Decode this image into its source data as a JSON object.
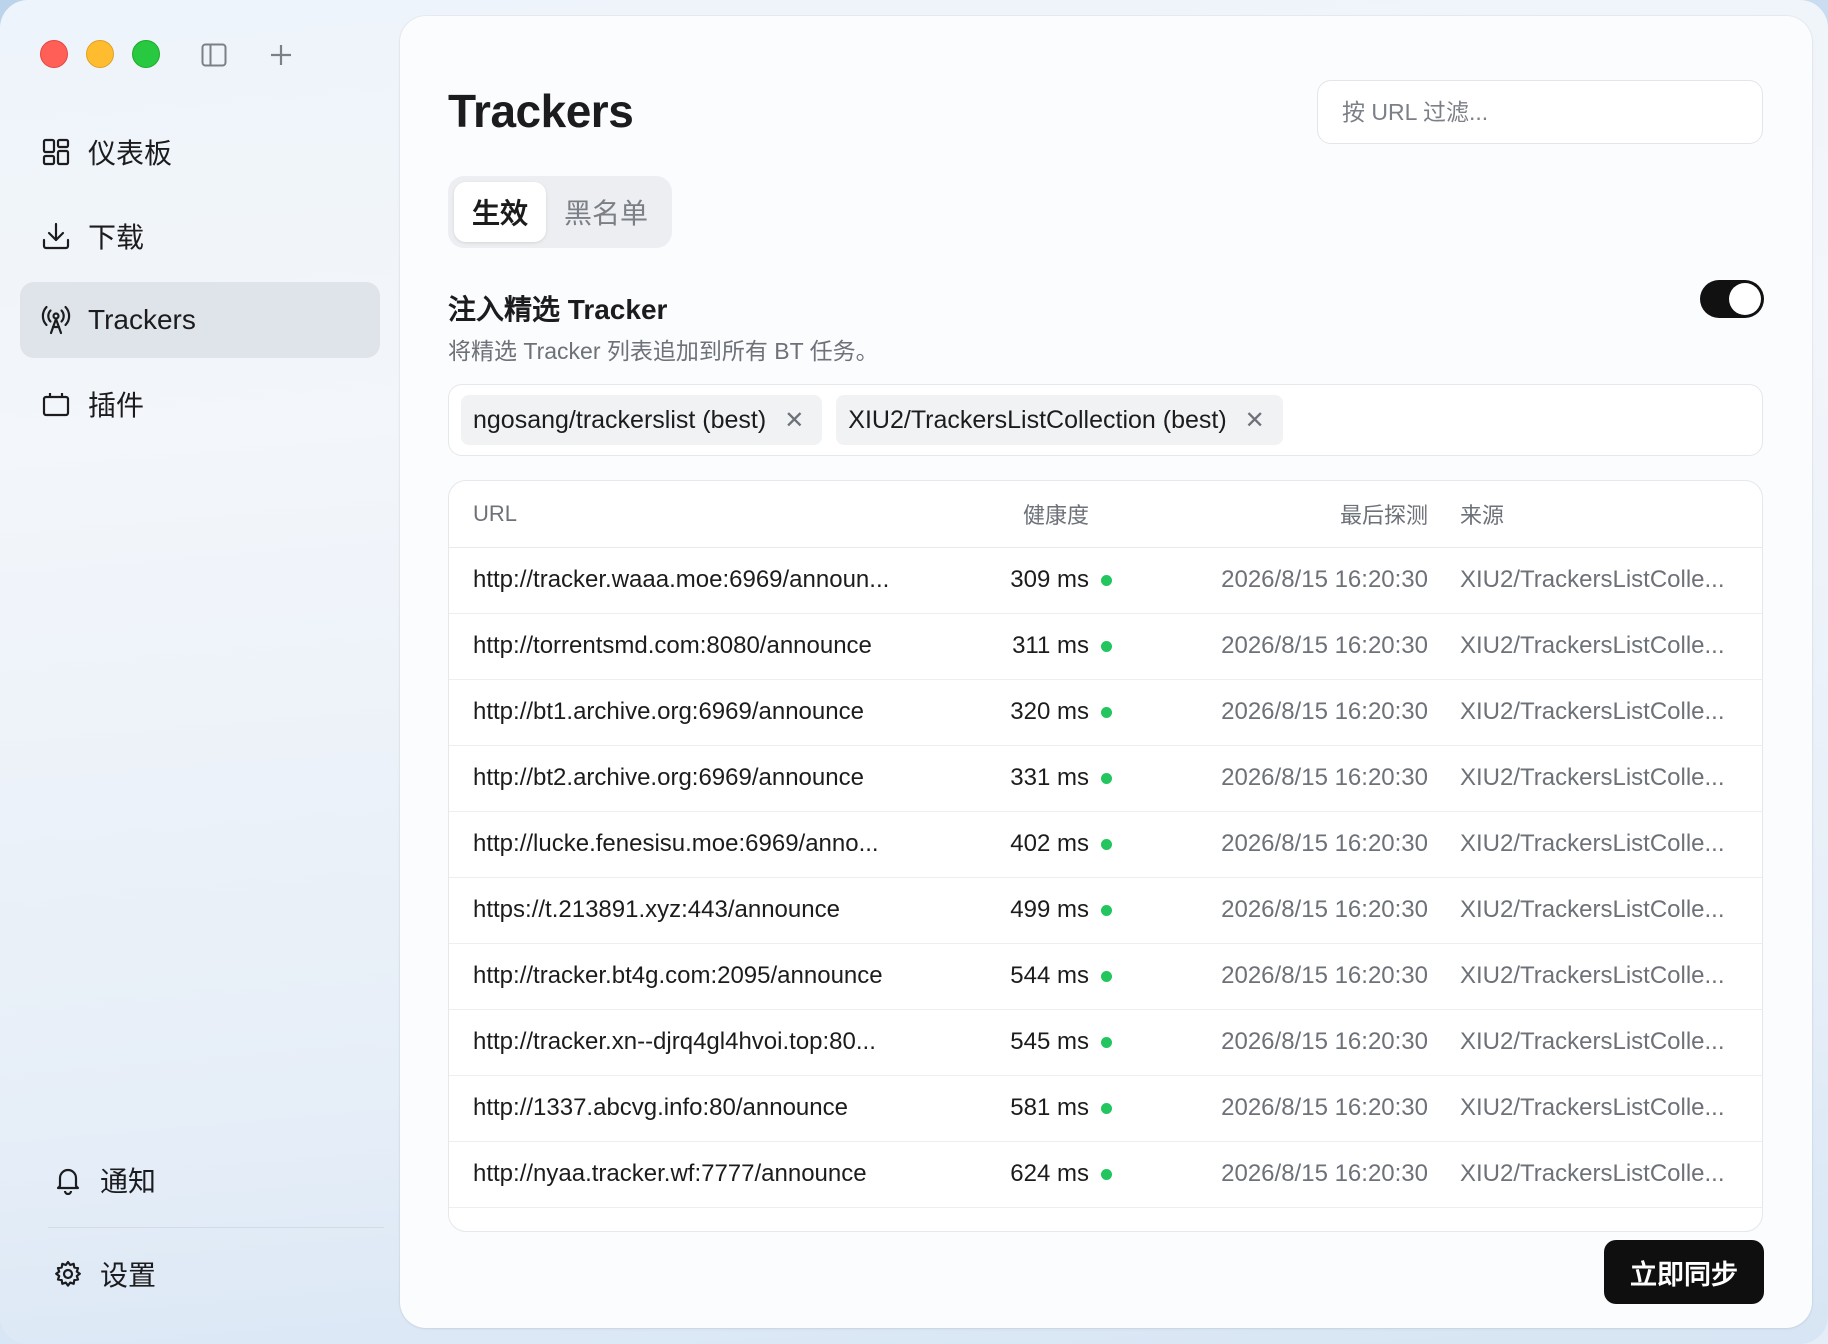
{
  "window": {
    "sidebar": {
      "nav": [
        {
          "id": "dashboard",
          "label": "仪表板",
          "icon": "dashboard-icon",
          "active": false
        },
        {
          "id": "downloads",
          "label": "下载",
          "icon": "download-icon",
          "active": false
        },
        {
          "id": "trackers",
          "label": "Trackers",
          "icon": "antenna-icon",
          "active": true
        },
        {
          "id": "plugins",
          "label": "插件",
          "icon": "plugin-icon",
          "active": false
        }
      ],
      "notifications_label": "通知",
      "settings_label": "设置"
    }
  },
  "main": {
    "title": "Trackers",
    "search_placeholder": "按 URL 过滤...",
    "tabs": [
      {
        "label": "生效",
        "active": true
      },
      {
        "label": "黑名单",
        "active": false
      }
    ],
    "inject": {
      "title": "注入精选 Tracker",
      "description": "将精选 Tracker 列表追加到所有 BT 任务。",
      "enabled": true
    },
    "sources": [
      "ngosang/trackerslist (best)",
      "XIU2/TrackersListCollection (best)"
    ],
    "table": {
      "headers": {
        "url": "URL",
        "health": "健康度",
        "last_probe": "最后探测",
        "source": "来源"
      },
      "rows": [
        {
          "url": "http://tracker.waaa.moe:6969/announ...",
          "health": "309 ms",
          "time": "2026/8/15 16:20:30",
          "source": "XIU2/TrackersListColle..."
        },
        {
          "url": "http://torrentsmd.com:8080/announce",
          "health": "311 ms",
          "time": "2026/8/15 16:20:30",
          "source": "XIU2/TrackersListColle..."
        },
        {
          "url": "http://bt1.archive.org:6969/announce",
          "health": "320 ms",
          "time": "2026/8/15 16:20:30",
          "source": "XIU2/TrackersListColle..."
        },
        {
          "url": "http://bt2.archive.org:6969/announce",
          "health": "331 ms",
          "time": "2026/8/15 16:20:30",
          "source": "XIU2/TrackersListColle..."
        },
        {
          "url": "http://lucke.fenesisu.moe:6969/anno...",
          "health": "402 ms",
          "time": "2026/8/15 16:20:30",
          "source": "XIU2/TrackersListColle..."
        },
        {
          "url": "https://t.213891.xyz:443/announce",
          "health": "499 ms",
          "time": "2026/8/15 16:20:30",
          "source": "XIU2/TrackersListColle..."
        },
        {
          "url": "http://tracker.bt4g.com:2095/announce",
          "health": "544 ms",
          "time": "2026/8/15 16:20:30",
          "source": "XIU2/TrackersListColle..."
        },
        {
          "url": "http://tracker.xn--djrq4gl4hvoi.top:80...",
          "health": "545 ms",
          "time": "2026/8/15 16:20:30",
          "source": "XIU2/TrackersListColle..."
        },
        {
          "url": "http://1337.abcvg.info:80/announce",
          "health": "581 ms",
          "time": "2026/8/15 16:20:30",
          "source": "XIU2/TrackersListColle..."
        },
        {
          "url": "http://nyaa.tracker.wf:7777/announce",
          "health": "624 ms",
          "time": "2026/8/15 16:20:30",
          "source": "XIU2/TrackersListColle..."
        }
      ]
    },
    "sync_button": "立即同步"
  },
  "colors": {
    "health_good": "#22c55e",
    "accent": "#0f0f10"
  }
}
